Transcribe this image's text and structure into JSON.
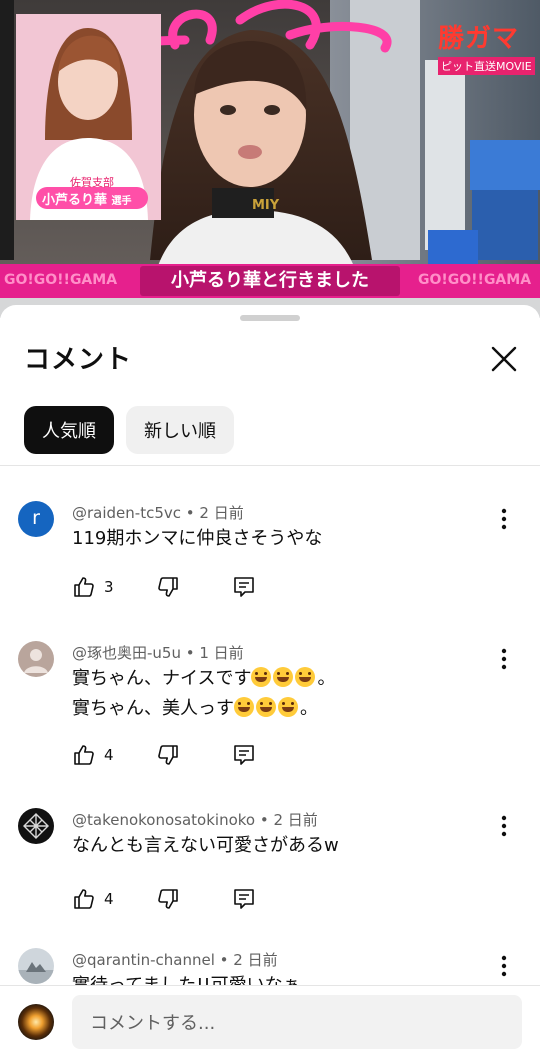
{
  "video": {
    "caption": "小芦るり華と行きました",
    "brand": "勝ガマ",
    "brand_sub": "ピット直送MOVIE",
    "inset_branch": "佐賀支部",
    "inset_name": "小芦るり華",
    "inset_suffix": "選手",
    "shirt_text": "MIY",
    "banner_text": "GO!GO!!GAMA"
  },
  "panel": {
    "title": "コメント",
    "sort_tabs": [
      {
        "label": "人気順",
        "active": true
      },
      {
        "label": "新しい順",
        "active": false
      }
    ]
  },
  "comments": [
    {
      "author": "@raiden-tc5vc",
      "time": "2 日前",
      "text_lines": [
        "119期ホンマに仲良さそうやな"
      ],
      "likes": "3",
      "avatar": "letter-avatar",
      "avatar_letter": "r",
      "avatar_color": "#1565c0"
    },
    {
      "author": "@琢也奥田-u5u",
      "time": "1 日前",
      "text_lines": [
        "實ちゃん、ナイスです",
        "實ちゃん、美人っす"
      ],
      "line_suffix": [
        "。",
        "。"
      ],
      "emoji_count": 3,
      "likes": "4",
      "avatar": "default-person-avatar"
    },
    {
      "author": "@takenokonosatokinoko",
      "time": "2 日前",
      "text_lines": [
        "なんとも言えない可愛さがあるw"
      ],
      "likes": "4",
      "avatar": "geometric-logo-avatar"
    },
    {
      "author": "@qarantin-channel",
      "time": "2 日前",
      "text_lines": [
        "實待ってました!!可愛いなぁ"
      ],
      "avatar": "landscape-photo-avatar"
    }
  ],
  "compose": {
    "placeholder": "コメントする..."
  },
  "icons": [
    "thumbs-up-icon",
    "thumbs-down-icon",
    "reply-icon",
    "more-vert-icon",
    "close-icon"
  ],
  "colors": {
    "accent_pink": "#ff3fa7",
    "chip_active": "#0f0f0f",
    "chip_inactive": "#f0f0f0",
    "meta_text": "#606060"
  }
}
